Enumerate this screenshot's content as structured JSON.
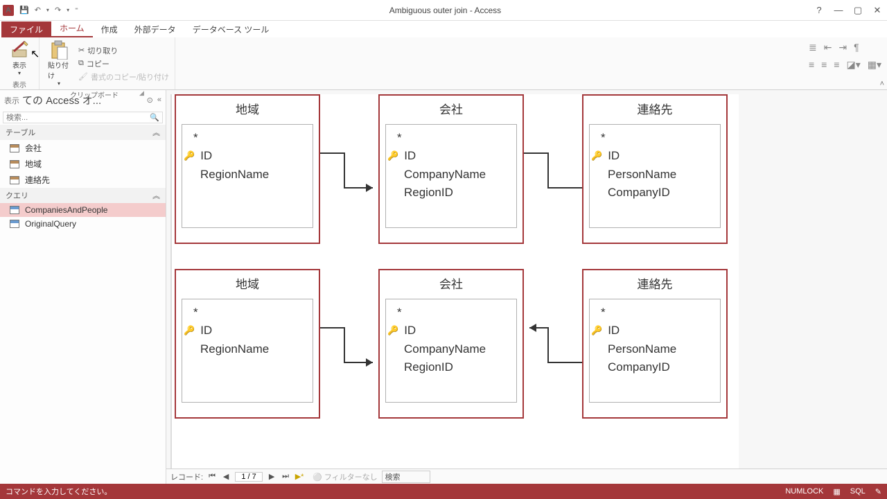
{
  "title": "Ambiguous outer join - Access",
  "qat": {
    "undo": "↶",
    "redo": "↷"
  },
  "tabs": {
    "file": "ファイル",
    "home": "ホーム",
    "create": "作成",
    "external": "外部データ",
    "dbtools": "データベース ツール"
  },
  "ribbon": {
    "view_label": "表示",
    "view_group": "表示",
    "paste_label": "貼り付け",
    "cut": "切り取り",
    "copy": "コピー",
    "format_painter": "書式のコピー/貼り付け",
    "clipboard_group": "クリップボード"
  },
  "nav": {
    "header": "ての Access オ...",
    "header_prefix": "表示",
    "search_placeholder": "検索...",
    "tables_section": "テーブル",
    "queries_section": "クエリ",
    "tables": [
      "会社",
      "地域",
      "連絡先"
    ],
    "queries": [
      "CompaniesAndPeople",
      "OriginalQuery"
    ]
  },
  "diagram": {
    "table1": {
      "title": "地域",
      "fields": [
        "ID",
        "RegionName"
      ]
    },
    "table2": {
      "title": "会社",
      "fields": [
        "ID",
        "CompanyName",
        "RegionID"
      ]
    },
    "table3": {
      "title": "連絡先",
      "fields": [
        "ID",
        "PersonName",
        "CompanyID"
      ]
    },
    "star": "*"
  },
  "recordnav": {
    "label": "レコード:",
    "position": "1 / 7",
    "no_filter": "フィルターなし",
    "search": "検索"
  },
  "status": {
    "msg": "コマンドを入力してください。",
    "numlock": "NUMLOCK",
    "sql": "SQL"
  }
}
